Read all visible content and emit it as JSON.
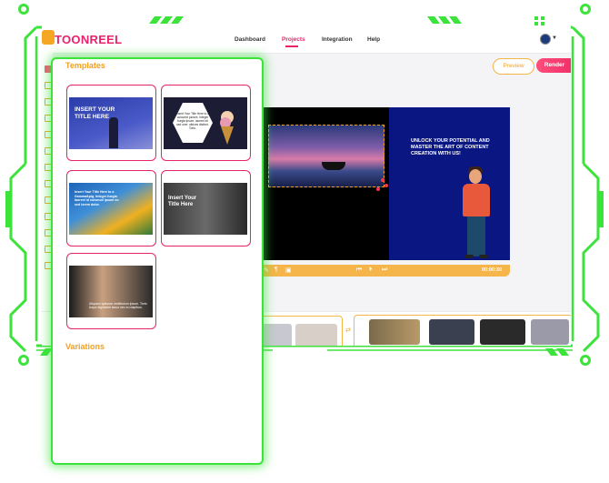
{
  "app": {
    "logo_text": "TOONREEL",
    "nav": [
      {
        "label": "Dashboard"
      },
      {
        "label": "Projects"
      },
      {
        "label": "Integration"
      },
      {
        "label": "Help"
      }
    ],
    "active_nav": "Projects",
    "preview_label": "Preview",
    "render_label": "Render"
  },
  "canvas": {
    "headline": "UNLOCK YOUR POTENTIAL AND MASTER THE ART OF CONTENT CREATION WITH US!",
    "time": "00:00:30"
  },
  "panel": {
    "templates_title": "Templates",
    "variations_title": "Variations",
    "templates": [
      {
        "text": "INSERT YOUR TITLE HERE",
        "icon": "person-silhouette"
      },
      {
        "text": "Insert Your Title Here to a coloured picture. Integer fuegia ipsum. laoreet sit sed over. ultrices distinct. Torto.",
        "icon": "ice-cream"
      },
      {
        "text": "Insert Your Title Here to a Gamma&pig. Integer fuegia laoreet id euismod ipsum eu sed lorem dolor.",
        "icon": "flowers"
      },
      {
        "text": "Insert Your Title Here",
        "icon": "office"
      },
      {
        "text": "Aliquam quismar vestibulum ipsum. Torto loops dignissim lacus nec eu dapibus.",
        "icon": "person-laptop"
      }
    ]
  },
  "colors": {
    "accent": "#e8236b",
    "orange": "#f5b54a",
    "green_frame": "#3be33b",
    "canvas_blue": "#0a1782"
  }
}
